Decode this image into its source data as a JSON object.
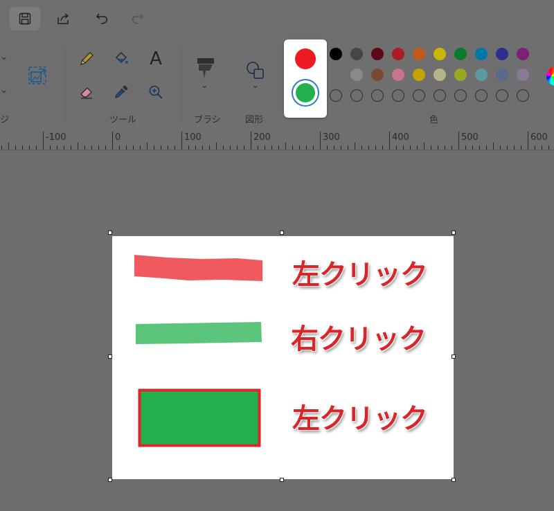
{
  "ribbon": {
    "group_image_label": "ジ",
    "group_tools_label": "ツール",
    "brush_label": "ブラシ",
    "shapes_label": "図形",
    "colors_label": "色"
  },
  "icons": {
    "save": "save-icon",
    "share": "share-icon",
    "undo": "undo-icon",
    "redo": "redo-icon",
    "resize": "resize-image-icon",
    "pencil": "pencil-icon",
    "fill": "fill-bucket-icon",
    "text": "text-icon",
    "eraser": "eraser-icon",
    "picker": "color-picker-icon",
    "magnifier": "magnifier-icon",
    "brush": "brush-icon",
    "shapes": "shapes-icon"
  },
  "tools": {
    "text_glyph": "A"
  },
  "colors": {
    "color1": "#ed1c24",
    "color2": "#22b14c",
    "palette_row1": [
      "#000000",
      "#464646",
      "#5a0b16",
      "#ae1b24",
      "#c45a1a",
      "#c8b800",
      "#0c7a2e",
      "#0077a8",
      "#2e2e8f",
      "#7a2278"
    ],
    "palette_row2": [
      "#6f6f6f",
      "#8a8a8a",
      "#7a4a30",
      "#c8758a",
      "#c8a200",
      "#b8b48a",
      "#98a820",
      "#5a9aa0",
      "#5a6a8a",
      "#8a7a98"
    ]
  },
  "ruler": {
    "ticks": [
      "-100",
      "0",
      "100",
      "200",
      "300",
      "400",
      "500",
      "600"
    ]
  },
  "canvas": {
    "label_top": "左クリック",
    "label_middle": "右クリック",
    "label_bottom": "左クリック",
    "stroke1_color": "#f05a5f",
    "stroke2_color": "#5cc57c",
    "rect_fill": "#22b14c",
    "rect_outline": "#e0262c"
  }
}
